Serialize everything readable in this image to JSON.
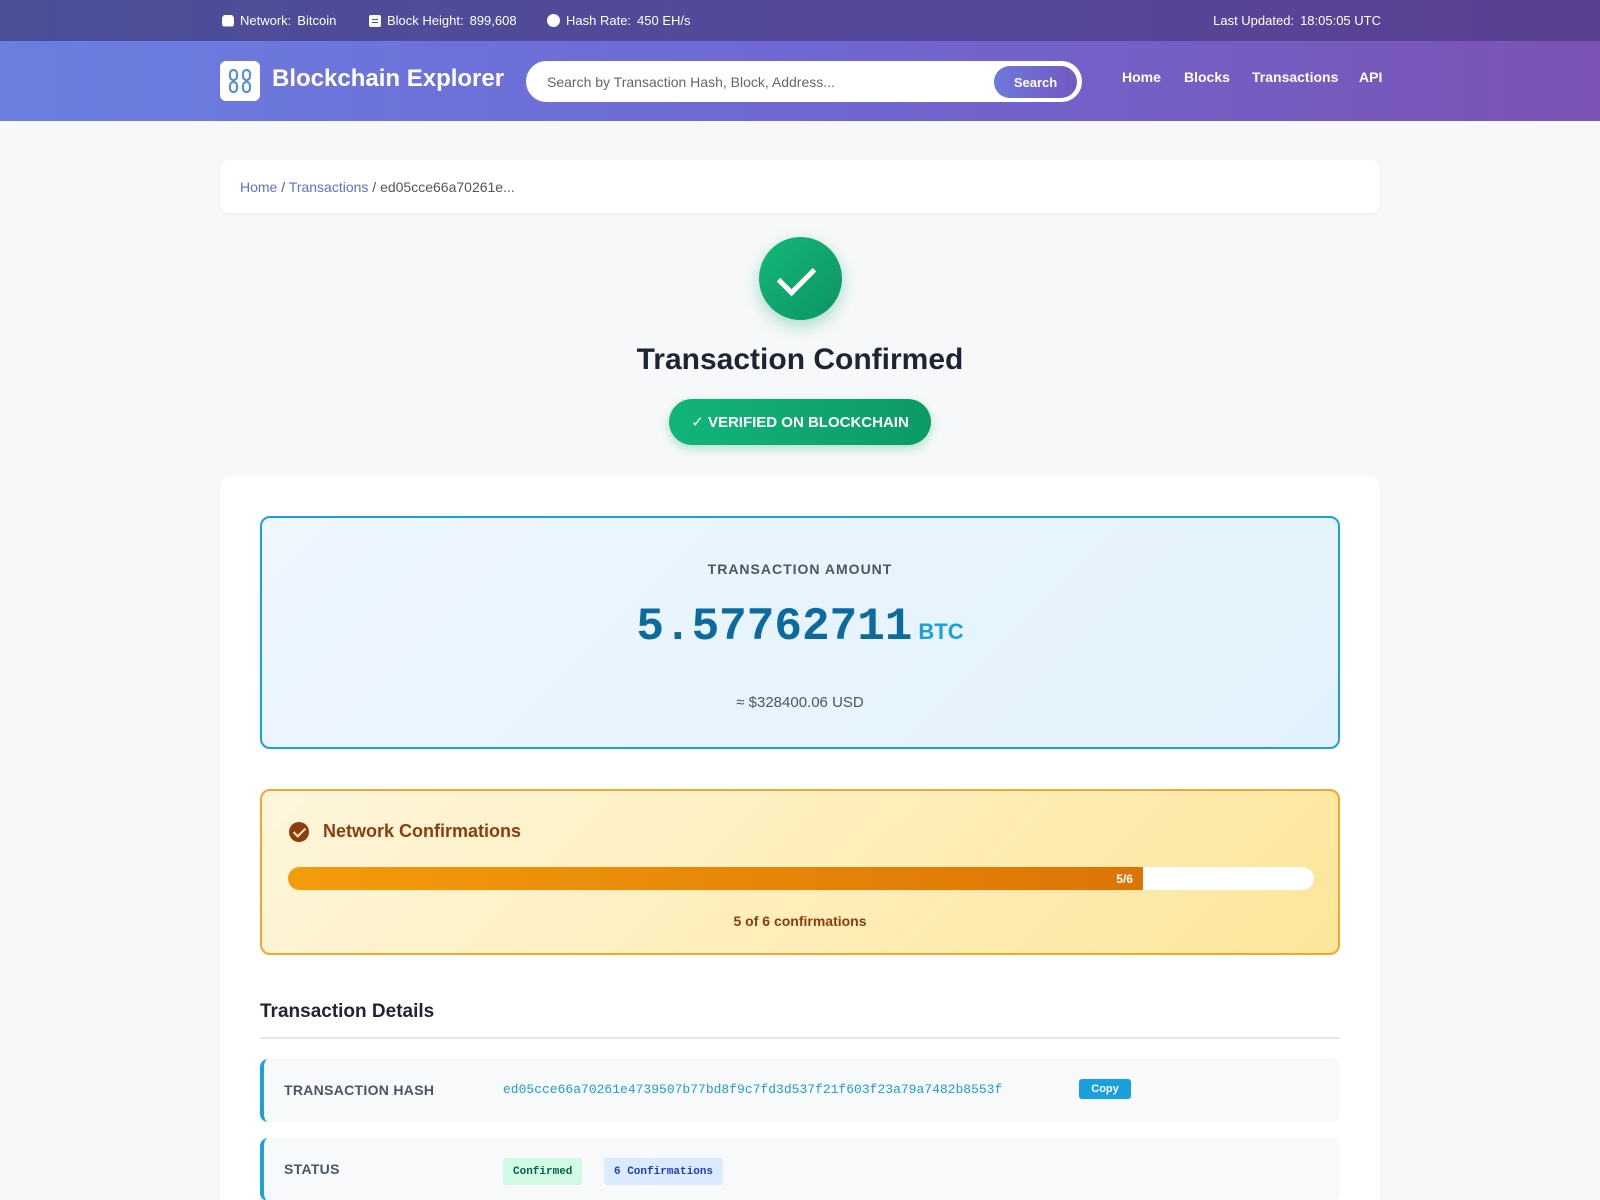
{
  "topbar": {
    "network_label": "Network:",
    "network_value": "Bitcoin",
    "block_label": "Block Height:",
    "block_value": "899,608",
    "hash_label": "Hash Rate:",
    "hash_value": "450 EH/s",
    "updated_label": "Last Updated:",
    "updated_value": "18:05:05 UTC"
  },
  "header": {
    "logo_icon": "chain-link-icon",
    "title": "Blockchain Explorer",
    "search_placeholder": "Search by Transaction Hash, Block, Address...",
    "search_button": "Search",
    "nav": [
      "Home",
      "Blocks",
      "Transactions",
      "API"
    ]
  },
  "breadcrumb": {
    "home": "Home",
    "sep1": "/",
    "transactions": "Transactions",
    "sep2": "/",
    "current": "ed05cce66a70261e..."
  },
  "hero": {
    "title": "Transaction Confirmed",
    "badge": "✓ VERIFIED ON BLOCKCHAIN"
  },
  "amount": {
    "label": "TRANSACTION AMOUNT",
    "value": "5.57762711",
    "unit": "BTC",
    "usd": "≈ $328400.06 USD"
  },
  "confirmations": {
    "title": "Network Confirmations",
    "progress_label": "5/6",
    "progress_fraction": 0.8333,
    "summary": "5 of 6 confirmations"
  },
  "details": {
    "title": "Transaction Details",
    "rows": [
      {
        "label": "TRANSACTION HASH",
        "value": "ed05cce66a70261e4739507b77bd8f9c7fd3d537f21f603f23a79a7482b8553f",
        "action": "Copy"
      },
      {
        "label": "STATUS",
        "tags": [
          "Confirmed",
          "6 Confirmations"
        ]
      }
    ]
  },
  "colors": {
    "accent": "#6b7ddc",
    "success": "#10b07a",
    "amount": "#0b6a9e",
    "warning": "#f0a92a"
  }
}
